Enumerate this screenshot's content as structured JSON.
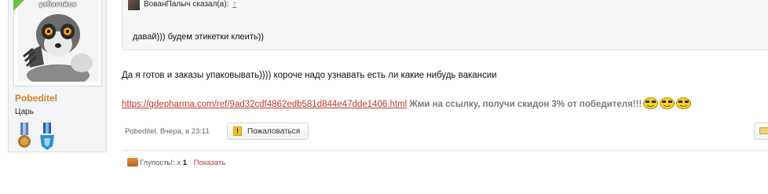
{
  "user": {
    "avatar_caption": "узбагойся",
    "name": "Pobeditel",
    "title": "Царь"
  },
  "quote": {
    "author": "ВованПалыч сказал(а):",
    "arrow": "↑",
    "text": "давай))) будем этикетки клеить))"
  },
  "message": {
    "line1": "Да я готов и заказы упаковывать)))) короче надо узнавать есть ли какие нибудь вакансии",
    "link": "https://gdepharma.com/ref/9ad32cdf4862edb581d844e47dde1406.html",
    "promo": "Жми на ссылку, получи скидон 3% от победителя!!!"
  },
  "meta": {
    "author_time": "Pobeditel, Вчера, в 23:11",
    "report_label": "Пожаловаться",
    "report_icon_glyph": "!"
  },
  "likes": {
    "label": "Глупость!: x",
    "count": "1",
    "show_label": "Показать"
  },
  "colors": {
    "username": "#d6802b",
    "link": "#c0392b",
    "online": "#6fbd45"
  }
}
